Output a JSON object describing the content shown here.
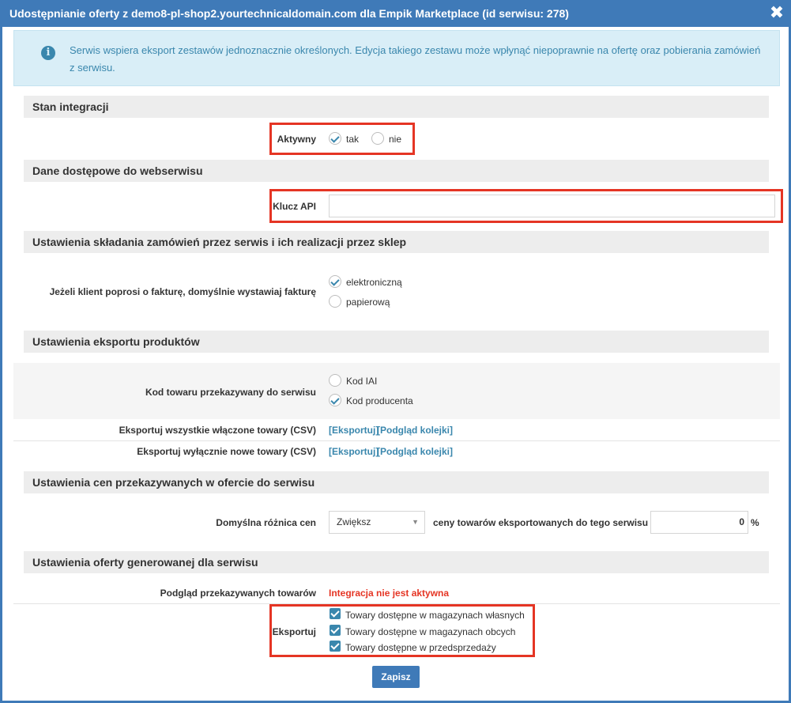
{
  "window": {
    "title": "Udostępnianie oferty z demo8-pl-shop2.yourtechnicaldomain.com dla Empik Marketplace (id serwisu: 278)",
    "close": "✖"
  },
  "info": {
    "icon": "i",
    "text": "Serwis wspiera eksport zestawów jednoznacznie określonych. Edycja takiego zestawu może wpłynąć niepoprawnie na ofertę oraz pobierania zamówień z serwisu."
  },
  "sections": {
    "integration": {
      "title": "Stan integracji",
      "active_label": "Aktywny",
      "yes": "tak",
      "no": "nie"
    },
    "access": {
      "title": "Dane dostępowe do webserwisu",
      "api_key_label": "Klucz API",
      "api_key_value": ""
    },
    "orders": {
      "title": "Ustawienia składania zamówień przez serwis i ich realizacji przez sklep",
      "invoice_label": "Jeżeli klient poprosi o fakturę, domyślnie wystawiaj fakturę",
      "electronic": "elektroniczną",
      "paper": "papierową"
    },
    "export": {
      "title": "Ustawienia eksportu produktów",
      "code_label": "Kod towaru przekazywany do serwisu",
      "code_iai": "Kod IAI",
      "code_producer": "Kod producenta",
      "export_all_label": "Eksportuj wszystkie włączone towary (CSV)",
      "export_new_label": "Eksportuj wyłącznie nowe towary (CSV)",
      "export_link": "[Eksportuj]",
      "queue_link": "[Podgląd kolejki]"
    },
    "prices": {
      "title": "Ustawienia cen przekazywanych w ofercie do serwisu",
      "diff_label": "Domyślna różnica cen",
      "select_value": "Zwiększ",
      "middle_text": "ceny towarów eksportowanych do tego serwisu o",
      "percent_value": "0",
      "percent_sign": "%"
    },
    "offer": {
      "title": "Ustawienia oferty generowanej dla serwisu",
      "preview_label": "Podgląd przekazywanych towarów",
      "preview_status": "Integracja nie jest aktywna",
      "export_label": "Eksportuj",
      "own_stock": "Towary dostępne w magazynach własnych",
      "foreign_stock": "Towary dostępne w magazynach obcych",
      "presale": "Towary dostępne w przedsprzedaży"
    }
  },
  "actions": {
    "save": "Zapisz"
  },
  "colors": {
    "accent": "#3f7ab8",
    "highlight": "#e53524",
    "status_error": "#e53524"
  }
}
